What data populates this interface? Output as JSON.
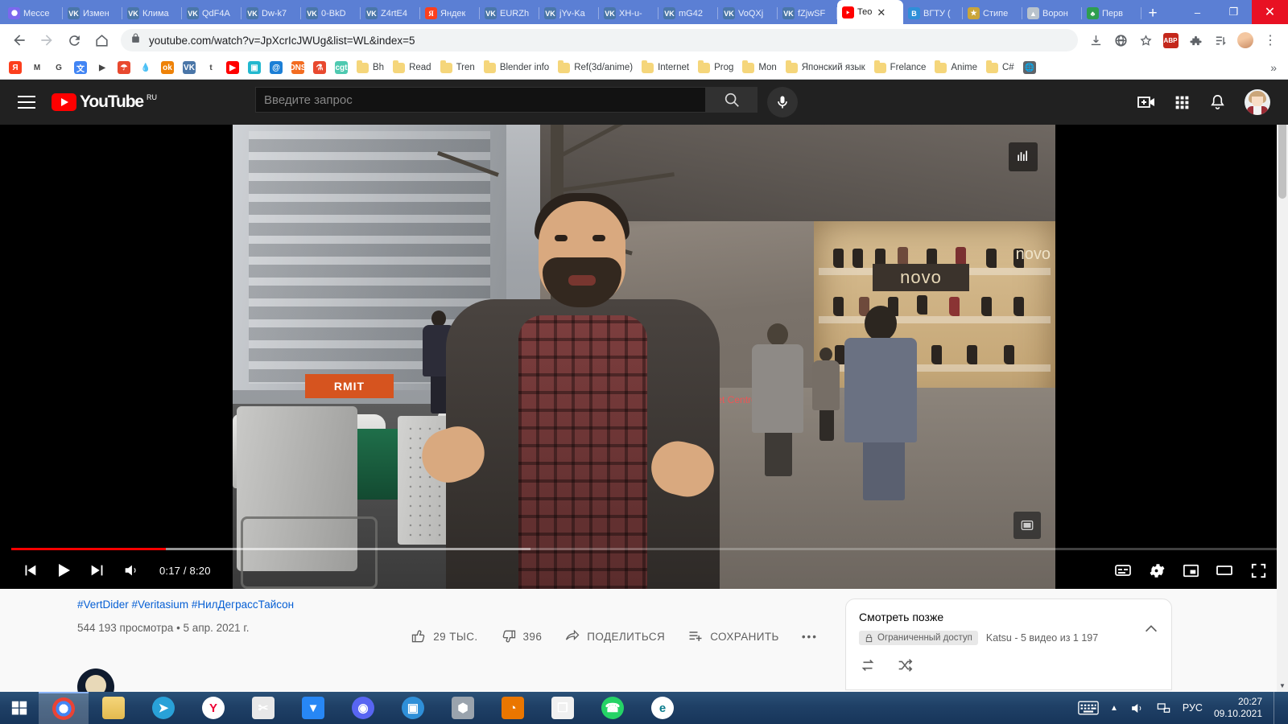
{
  "window": {
    "minimize_label": "–",
    "maximize_label": "❐",
    "close_label": "✕",
    "newtab_label": "+"
  },
  "tabs": [
    {
      "label": "Мессе",
      "icon": "messenger-icon",
      "type": "msg",
      "active": false
    },
    {
      "label": "Измен",
      "icon": "vk-icon",
      "type": "vk",
      "active": false
    },
    {
      "label": "Клима",
      "icon": "vk-icon",
      "type": "vk",
      "active": false
    },
    {
      "label": "QdF4A",
      "icon": "vk-icon",
      "type": "vk",
      "active": false
    },
    {
      "label": "Dw-k7",
      "icon": "vk-icon",
      "type": "vk",
      "active": false
    },
    {
      "label": "0-BkD",
      "icon": "vk-icon",
      "type": "vk",
      "active": false
    },
    {
      "label": "Z4rtE4",
      "icon": "vk-icon",
      "type": "vk",
      "active": false
    },
    {
      "label": "Яндек",
      "icon": "yandex-icon",
      "type": "ya",
      "active": false
    },
    {
      "label": "EURZh",
      "icon": "vk-icon",
      "type": "vk",
      "active": false
    },
    {
      "label": "jYv-Ka",
      "icon": "vk-icon",
      "type": "vk",
      "active": false
    },
    {
      "label": "XH-u-",
      "icon": "vk-icon",
      "type": "vk",
      "active": false
    },
    {
      "label": "mG42",
      "icon": "vk-icon",
      "type": "vk",
      "active": false
    },
    {
      "label": "VoQXj",
      "icon": "vk-icon",
      "type": "vk",
      "active": false
    },
    {
      "label": "fZjwSF",
      "icon": "vk-icon",
      "type": "vk",
      "active": false
    },
    {
      "label": "Тео",
      "icon": "youtube-icon",
      "type": "yt",
      "active": true
    },
    {
      "label": "ВГТУ (",
      "icon": "vgtu-icon",
      "type": "vgtu",
      "active": false
    },
    {
      "label": "Стипе",
      "icon": "emblem-icon",
      "type": "gold",
      "active": false
    },
    {
      "label": "Ворон",
      "icon": "crest-icon",
      "type": "grey",
      "active": false
    },
    {
      "label": "Перв",
      "icon": "tree-icon",
      "type": "green",
      "active": false
    }
  ],
  "toolbar": {
    "back_label": "←",
    "forward_label": "→",
    "reload_label": "↻",
    "home_label": "⌂",
    "url": "youtube.com/watch?v=JpXcrIcJWUg&list=WL&index=5",
    "lock_icon": "lock-icon",
    "abp_label": "ABP",
    "extensions_icon": "puzzle-icon",
    "star_icon": "star-icon",
    "translate_icon": "translate-icon",
    "download_icon": "download-icon",
    "reading_list_icon": "reading-list-icon",
    "menu_label": "⋮"
  },
  "bookmarks": [
    {
      "label": "",
      "icon": "yandex-icon",
      "glyph": "Я",
      "color": "#fc3f1d",
      "folder": false
    },
    {
      "label": "",
      "icon": "gmail-icon",
      "glyph": "M",
      "color": "#ffffff",
      "folder": false
    },
    {
      "label": "",
      "icon": "google-icon",
      "glyph": "G",
      "color": "#ffffff",
      "folder": false
    },
    {
      "label": "",
      "icon": "google-translate-icon",
      "glyph": "文",
      "color": "#4285f4",
      "folder": false
    },
    {
      "label": "",
      "icon": "play-icon",
      "glyph": "▶",
      "color": "#ffffff",
      "folder": false
    },
    {
      "label": "",
      "icon": "umbrella-icon",
      "glyph": "☂",
      "color": "#e8492f",
      "folder": false
    },
    {
      "label": "",
      "icon": "drop-icon",
      "glyph": "💧",
      "color": "#ffffff",
      "folder": false
    },
    {
      "label": "",
      "icon": "odnoklassniki-icon",
      "glyph": "ok",
      "color": "#ee8208",
      "folder": false
    },
    {
      "label": "",
      "icon": "vk-icon",
      "glyph": "VK",
      "color": "#4a76a8",
      "folder": false
    },
    {
      "label": "",
      "icon": "twitter-icon",
      "glyph": "t",
      "color": "#ffffff",
      "folder": false
    },
    {
      "label": "",
      "icon": "youtube-icon",
      "glyph": "▶",
      "color": "#ff0000",
      "folder": false
    },
    {
      "label": "",
      "icon": "robot-icon",
      "glyph": "▣",
      "color": "#22b8cf",
      "folder": false
    },
    {
      "label": "",
      "icon": "at-icon",
      "glyph": "@",
      "color": "#1c7fd6",
      "folder": false
    },
    {
      "label": "",
      "icon": "dns-icon",
      "glyph": "DNS",
      "color": "#f36c21",
      "folder": false
    },
    {
      "label": "",
      "icon": "flask-icon",
      "glyph": "⚗",
      "color": "#e8492f",
      "folder": false
    },
    {
      "label": "",
      "icon": "cgt-icon",
      "glyph": "cgt",
      "color": "#4ec9b0",
      "folder": false
    },
    {
      "label": "Bh",
      "icon": "folder-icon",
      "folder": true
    },
    {
      "label": "Read",
      "icon": "folder-icon",
      "folder": true
    },
    {
      "label": "Tren",
      "icon": "folder-icon",
      "folder": true
    },
    {
      "label": "Blender info",
      "icon": "folder-icon",
      "folder": true
    },
    {
      "label": "Ref(3d/anime)",
      "icon": "folder-icon",
      "folder": true
    },
    {
      "label": "Internet",
      "icon": "folder-icon",
      "folder": true
    },
    {
      "label": "Prog",
      "icon": "folder-icon",
      "folder": true
    },
    {
      "label": "Mon",
      "icon": "folder-icon",
      "folder": true
    },
    {
      "label": "Японский язык",
      "icon": "folder-icon",
      "folder": true
    },
    {
      "label": "Frelance",
      "icon": "folder-icon",
      "folder": true
    },
    {
      "label": "Anime",
      "icon": "folder-icon",
      "folder": true
    },
    {
      "label": "C#",
      "icon": "folder-icon",
      "folder": true
    },
    {
      "label": "",
      "icon": "globe-icon",
      "glyph": "🌐",
      "color": "#5f6368",
      "folder": false
    }
  ],
  "bookmarks_overflow_label": "»",
  "youtube": {
    "logo_text": "YouTube",
    "logo_country": "RU",
    "search_placeholder": "Введите запрос",
    "search_value": "",
    "search_icon": "search-icon",
    "mic_icon": "microphone-icon",
    "create_icon": "create-video-icon",
    "apps_icon": "apps-grid-icon",
    "notifications_icon": "bell-icon",
    "avatar_icon": "user-avatar"
  },
  "player": {
    "current_time": "0:17",
    "total_time": "8:20",
    "time_display": "0:17 / 8:20",
    "progress_percent": 12.2,
    "buffered_percent": 41,
    "prev_icon": "previous-video-icon",
    "play_icon": "play-icon",
    "next_icon": "next-video-icon",
    "volume_icon": "volume-icon",
    "subtitles_icon": "subtitles-icon",
    "settings_icon": "settings-gear-icon",
    "miniplayer_icon": "miniplayer-icon",
    "theater_icon": "theater-mode-icon",
    "fullscreen_icon": "fullscreen-icon",
    "overlay_badge_icon": "channel-watermark-icon",
    "corner_badge_icon": "video-card-icon",
    "scene_sign_primary": "novo",
    "scene_sign_secondary": "novo",
    "scene_sign_rmit": "RMIT",
    "scene_sign_target": "Target Centre"
  },
  "video_info": {
    "tags": "#VertDider #Veritasium #НилДеграссТайсон",
    "views": "544 193 просмотра",
    "separator": "•",
    "date": "5 апр. 2021 г.",
    "views_line": "544 193 просмотра • 5 апр. 2021 г."
  },
  "actions": {
    "like": {
      "label": "",
      "count": "29 ТЫС.",
      "icon": "thumbs-up-icon"
    },
    "dislike": {
      "label": "",
      "count": "396",
      "icon": "thumbs-down-icon"
    },
    "share": {
      "label": "ПОДЕЛИТЬСЯ",
      "icon": "share-icon"
    },
    "save": {
      "label": "СОХРАНИТЬ",
      "icon": "save-to-playlist-icon"
    },
    "more": {
      "label": "•••",
      "icon": "more-actions-icon"
    }
  },
  "playlist": {
    "title": "Смотреть позже",
    "privacy_badge": "Ограниченный доступ",
    "privacy_icon": "lock-icon",
    "owner_line": "Katsu - 5 видео из 1 197",
    "loop_icon": "loop-icon",
    "shuffle_icon": "shuffle-icon",
    "collapse_icon": "chevron-up-icon"
  },
  "taskbar": {
    "start_icon": "windows-start-icon",
    "items": [
      {
        "name": "chrome",
        "icon": "chrome-icon",
        "active": true
      },
      {
        "name": "explorer",
        "icon": "file-explorer-icon",
        "active": false
      },
      {
        "name": "telegram",
        "icon": "telegram-icon",
        "active": false
      },
      {
        "name": "yandex-browser",
        "icon": "yandex-browser-icon",
        "active": false
      },
      {
        "name": "snipping-tool",
        "icon": "snipping-tool-icon",
        "active": false
      },
      {
        "name": "vk",
        "icon": "vk-messenger-icon",
        "active": false
      },
      {
        "name": "discord",
        "icon": "discord-icon",
        "active": false
      },
      {
        "name": "bandicam",
        "icon": "bandicam-icon",
        "active": false
      },
      {
        "name": "3d-app",
        "icon": "3d-viewer-icon",
        "active": false
      },
      {
        "name": "blender",
        "icon": "blender-icon",
        "active": false
      },
      {
        "name": "copy-app",
        "icon": "copy-app-icon",
        "active": false
      },
      {
        "name": "whatsapp",
        "icon": "whatsapp-icon",
        "active": false
      },
      {
        "name": "edge",
        "icon": "edge-icon",
        "active": false
      }
    ],
    "tray": {
      "keyboard_icon": "keyboard-icon",
      "chevron_icon": "show-hidden-icons-icon",
      "volume_icon": "volume-icon",
      "network_icon": "network-icon",
      "language": "РУС",
      "time": "20:27",
      "date": "09.10.2021"
    }
  },
  "colors": {
    "chrome_tabstrip": "#5b7fd4",
    "youtube_red": "#ff0000",
    "link_blue": "#065fd4",
    "taskbar": "#1f4066",
    "accent_close": "#e81123"
  }
}
